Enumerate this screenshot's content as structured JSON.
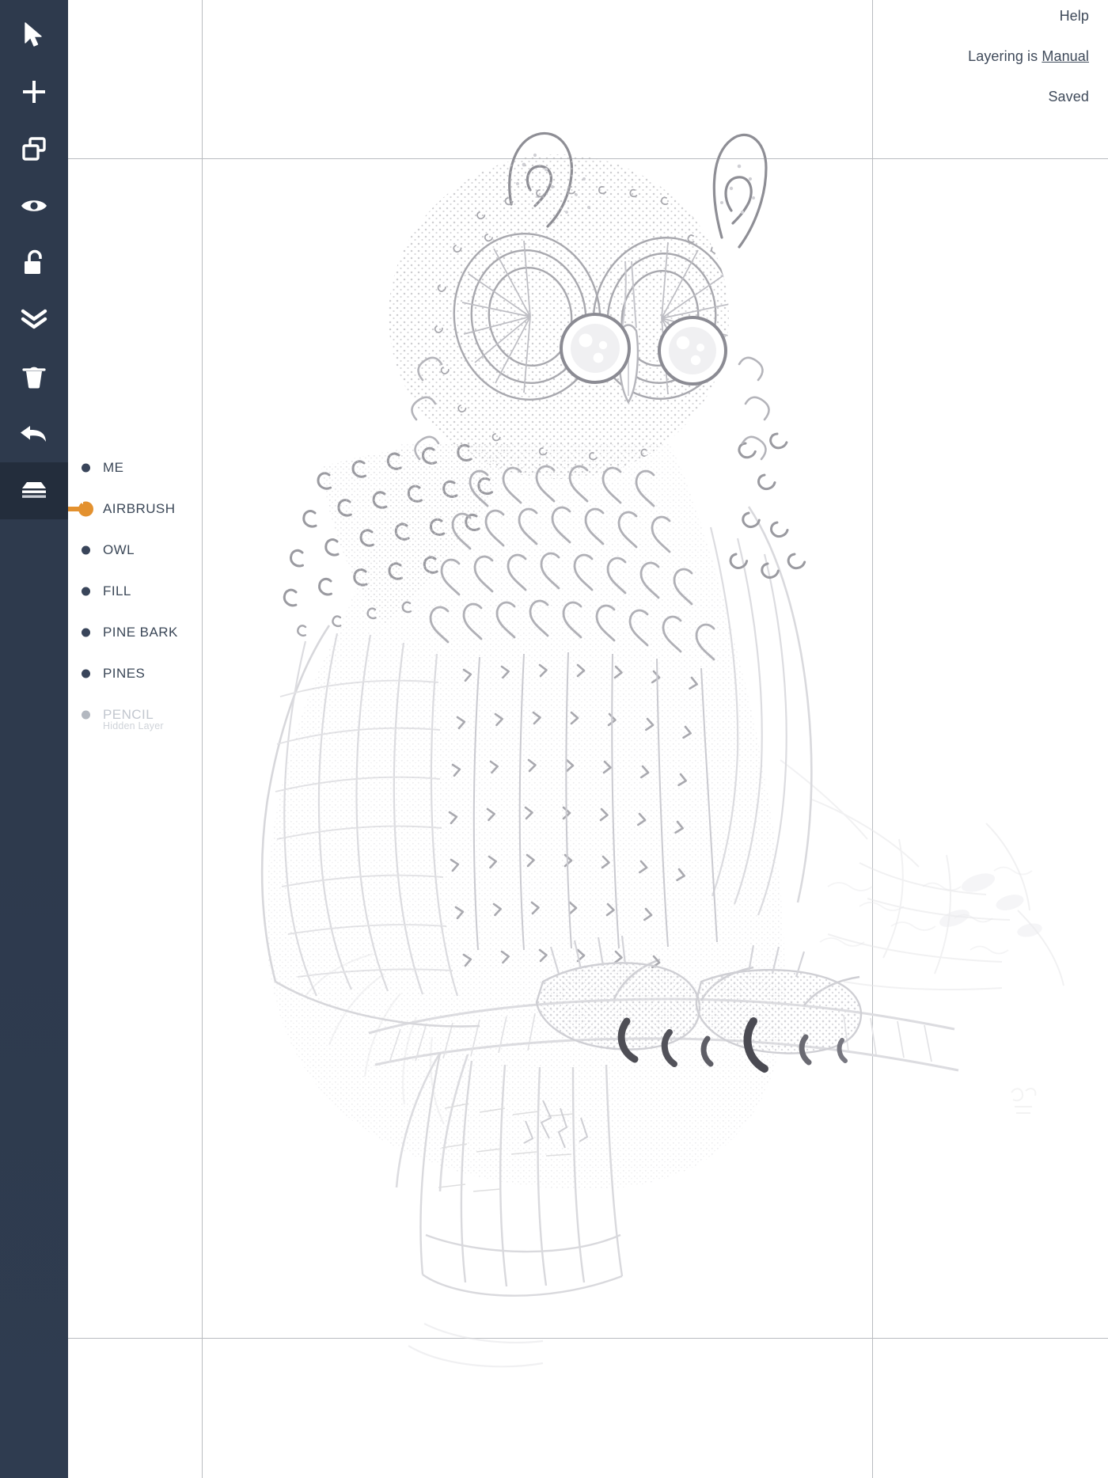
{
  "app": {
    "accent_color": "#e3912f",
    "sidebar_color": "#2e3a4d",
    "text_color": "#3f4a5a"
  },
  "toolbar": {
    "items": [
      {
        "icon": "cursor-select-icon",
        "name": "select-tool",
        "active": false
      },
      {
        "icon": "plus-icon",
        "name": "add-layer-tool",
        "active": false
      },
      {
        "icon": "duplicate-icon",
        "name": "duplicate-tool",
        "active": false
      },
      {
        "icon": "eye-icon",
        "name": "visibility-tool",
        "active": false
      },
      {
        "icon": "unlock-icon",
        "name": "lock-tool",
        "active": false
      },
      {
        "icon": "chevrons-down-icon",
        "name": "merge-down-tool",
        "active": false
      },
      {
        "icon": "trash-icon",
        "name": "delete-tool",
        "active": false
      },
      {
        "icon": "undo-arrow-icon",
        "name": "undo-tool",
        "active": false
      },
      {
        "icon": "layers-icon",
        "name": "layers-tool",
        "active": true
      }
    ]
  },
  "header": {
    "help_label": "Help",
    "layering_prefix": "Layering is ",
    "layering_mode": "Manual",
    "save_status": "Saved"
  },
  "layers": {
    "items": [
      {
        "label": "ME",
        "selected": false,
        "hidden": false,
        "sublabel": ""
      },
      {
        "label": "AIRBRUSH",
        "selected": true,
        "hidden": false,
        "sublabel": ""
      },
      {
        "label": "OWL",
        "selected": false,
        "hidden": false,
        "sublabel": ""
      },
      {
        "label": "FILL",
        "selected": false,
        "hidden": false,
        "sublabel": ""
      },
      {
        "label": "PINE BARK",
        "selected": false,
        "hidden": false,
        "sublabel": ""
      },
      {
        "label": "PINES",
        "selected": false,
        "hidden": false,
        "sublabel": ""
      },
      {
        "label": "PENCIL",
        "selected": false,
        "hidden": true,
        "sublabel": "Hidden Layer"
      }
    ]
  },
  "canvas": {
    "guides": {
      "vertical": [
        255,
        1102
      ],
      "horizontal": [
        200,
        1690
      ]
    },
    "artwork_title": "owl-line-drawing"
  }
}
